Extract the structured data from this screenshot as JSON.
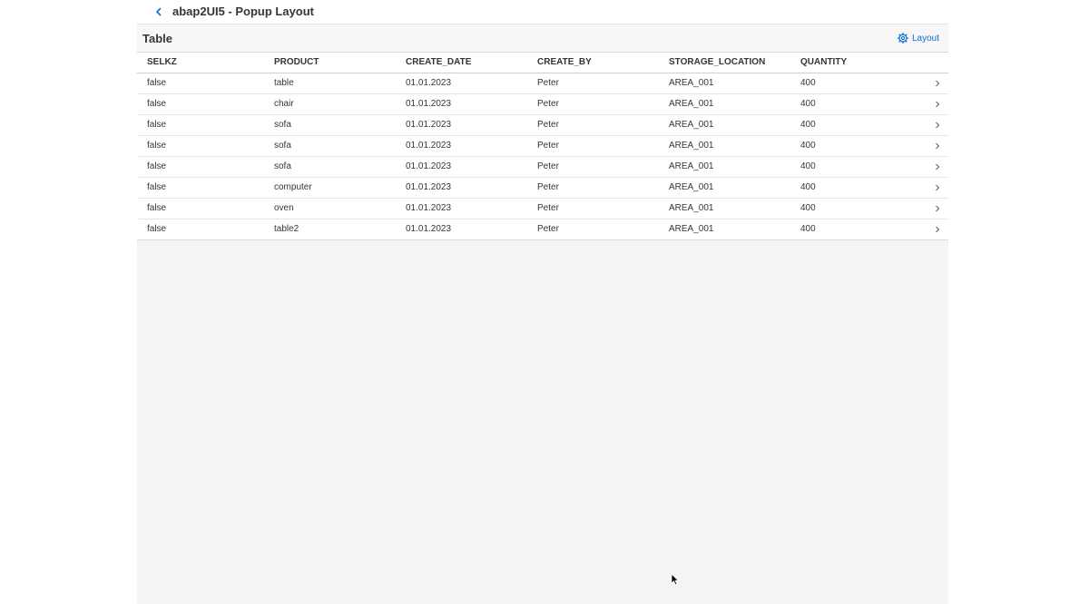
{
  "header": {
    "title": "abap2UI5 - Popup Layout",
    "back_icon": "chevron-left-icon"
  },
  "toolbar": {
    "table_title": "Table",
    "layout_label": "Layout",
    "layout_icon": "gear-icon"
  },
  "table": {
    "columns": [
      "SELKZ",
      "PRODUCT",
      "CREATE_DATE",
      "CREATE_BY",
      "STORAGE_LOCATION",
      "QUANTITY"
    ],
    "rows": [
      [
        "false",
        "table",
        "01.01.2023",
        "Peter",
        "AREA_001",
        "400"
      ],
      [
        "false",
        "chair",
        "01.01.2023",
        "Peter",
        "AREA_001",
        "400"
      ],
      [
        "false",
        "sofa",
        "01.01.2023",
        "Peter",
        "AREA_001",
        "400"
      ],
      [
        "false",
        "sofa",
        "01.01.2023",
        "Peter",
        "AREA_001",
        "400"
      ],
      [
        "false",
        "sofa",
        "01.01.2023",
        "Peter",
        "AREA_001",
        "400"
      ],
      [
        "false",
        "computer",
        "01.01.2023",
        "Peter",
        "AREA_001",
        "400"
      ],
      [
        "false",
        "oven",
        "01.01.2023",
        "Peter",
        "AREA_001",
        "400"
      ],
      [
        "false",
        "table2",
        "01.01.2023",
        "Peter",
        "AREA_001",
        "400"
      ]
    ],
    "row_nav_icon": "chevron-right-icon"
  },
  "colors": {
    "accent": "#0a6ed1",
    "text": "#32363a",
    "background": "#f3f4f6"
  }
}
